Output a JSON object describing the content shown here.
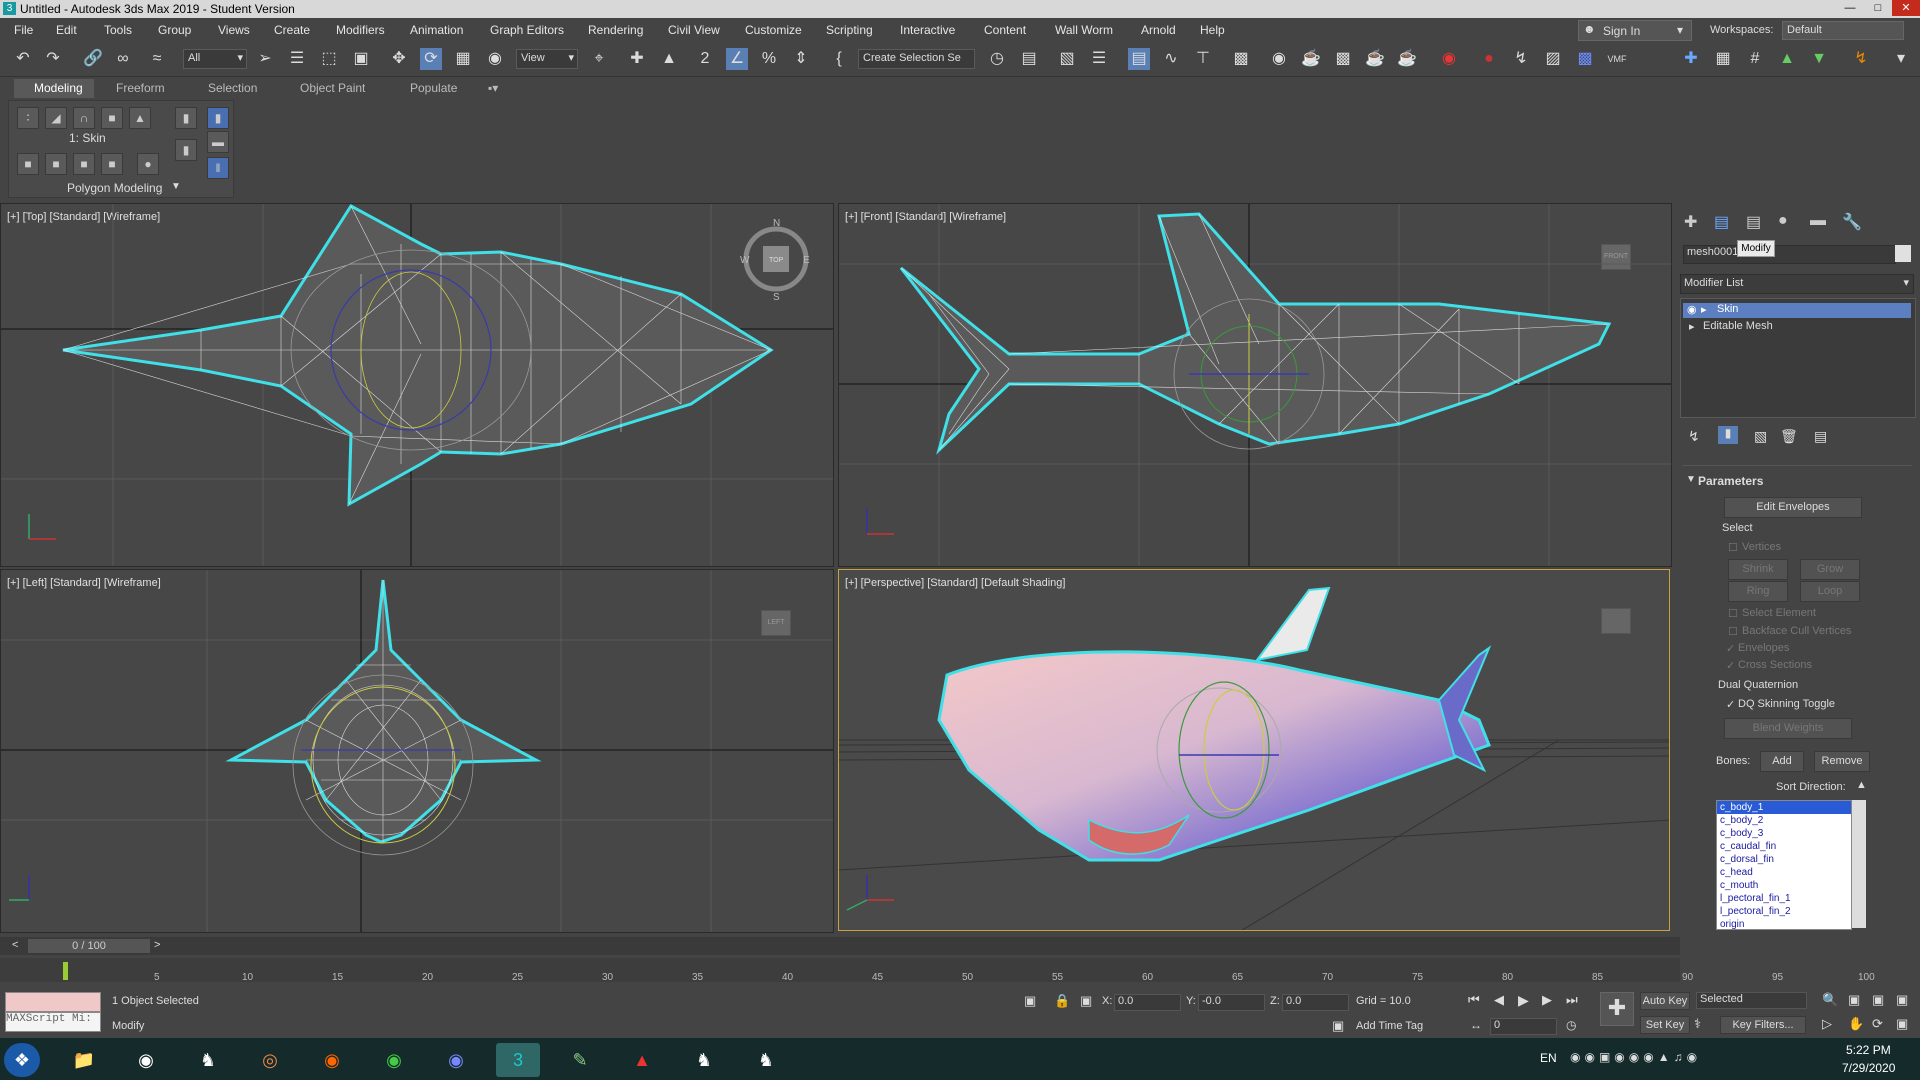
{
  "window": {
    "title": "Untitled - Autodesk 3ds Max 2019 - Student Version",
    "app_icon": "3"
  },
  "menu": [
    "File",
    "Edit",
    "Tools",
    "Group",
    "Views",
    "Create",
    "Modifiers",
    "Animation",
    "Graph Editors",
    "Rendering",
    "Civil View",
    "Customize",
    "Scripting",
    "Interactive",
    "Content",
    "Wall Worm",
    "Arnold",
    "Help"
  ],
  "account": {
    "sign_in": "Sign In",
    "workspaces_label": "Workspaces:",
    "workspace": "Default"
  },
  "toolbar": {
    "filter": "All",
    "refcoord": "View",
    "selection_set": "Create Selection Se"
  },
  "ribbon": {
    "tabs": [
      "Modeling",
      "Freeform",
      "Selection",
      "Object Paint",
      "Populate"
    ],
    "level": "1: Skin",
    "panel": "Polygon Modeling"
  },
  "viewports": {
    "top": "[+] [Top] [Standard] [Wireframe]",
    "front": "[+] [Front] [Standard] [Wireframe]",
    "left": "[+] [Left] [Standard] [Wireframe]",
    "perspective": "[+] [Perspective] [Standard] [Default Shading]",
    "compass": {
      "n": "N",
      "s": "S",
      "e": "E",
      "w": "W",
      "center": "TOP"
    },
    "cube_front": "FRONT",
    "cube_left": "LEFT"
  },
  "command_panel": {
    "object_name": "mesh0001",
    "tooltip": "Modify",
    "modifier_list": "Modifier List",
    "stack": [
      "Skin",
      "Editable Mesh"
    ],
    "parameters_title": "Parameters",
    "edit_envelopes": "Edit Envelopes",
    "select_label": "Select",
    "vertices": "Vertices",
    "shrink": "Shrink",
    "grow": "Grow",
    "ring": "Ring",
    "loop": "Loop",
    "select_element": "Select Element",
    "backface": "Backface Cull Vertices",
    "envelopes": "Envelopes",
    "cross_sections": "Cross Sections",
    "dual_quaternion": "Dual Quaternion",
    "dq_toggle": "DQ Skinning Toggle",
    "blend_weights": "Blend Weights",
    "bones_label": "Bones:",
    "add": "Add",
    "remove": "Remove",
    "sort_direction": "Sort Direction:",
    "bones": [
      "c_body_1",
      "c_body_2",
      "c_body_3",
      "c_caudal_fin",
      "c_dorsal_fin",
      "c_head",
      "c_mouth",
      "l_pectoral_fin_1",
      "l_pectoral_fin_2",
      "origin"
    ]
  },
  "timeline": {
    "frame": "0 / 100",
    "ticks": [
      "5",
      "10",
      "15",
      "20",
      "25",
      "30",
      "35",
      "40",
      "45",
      "50",
      "55",
      "60",
      "65",
      "70",
      "75",
      "80",
      "85",
      "90",
      "95",
      "100"
    ]
  },
  "status": {
    "maxscript": "MAXScript Mi:",
    "selected": "1 Object Selected",
    "prompt": "Modify",
    "x": "0.0",
    "y": "-0.0",
    "z": "0.0",
    "grid": "Grid = 10.0",
    "add_time_tag": "Add Time Tag",
    "auto_key": "Auto Key",
    "set_key": "Set Key",
    "selected_mode": "Selected",
    "key_filters": "Key Filters...",
    "frame_value": "0"
  },
  "tray": {
    "lang": "EN",
    "time": "5:22 PM",
    "date": "7/29/2020"
  }
}
